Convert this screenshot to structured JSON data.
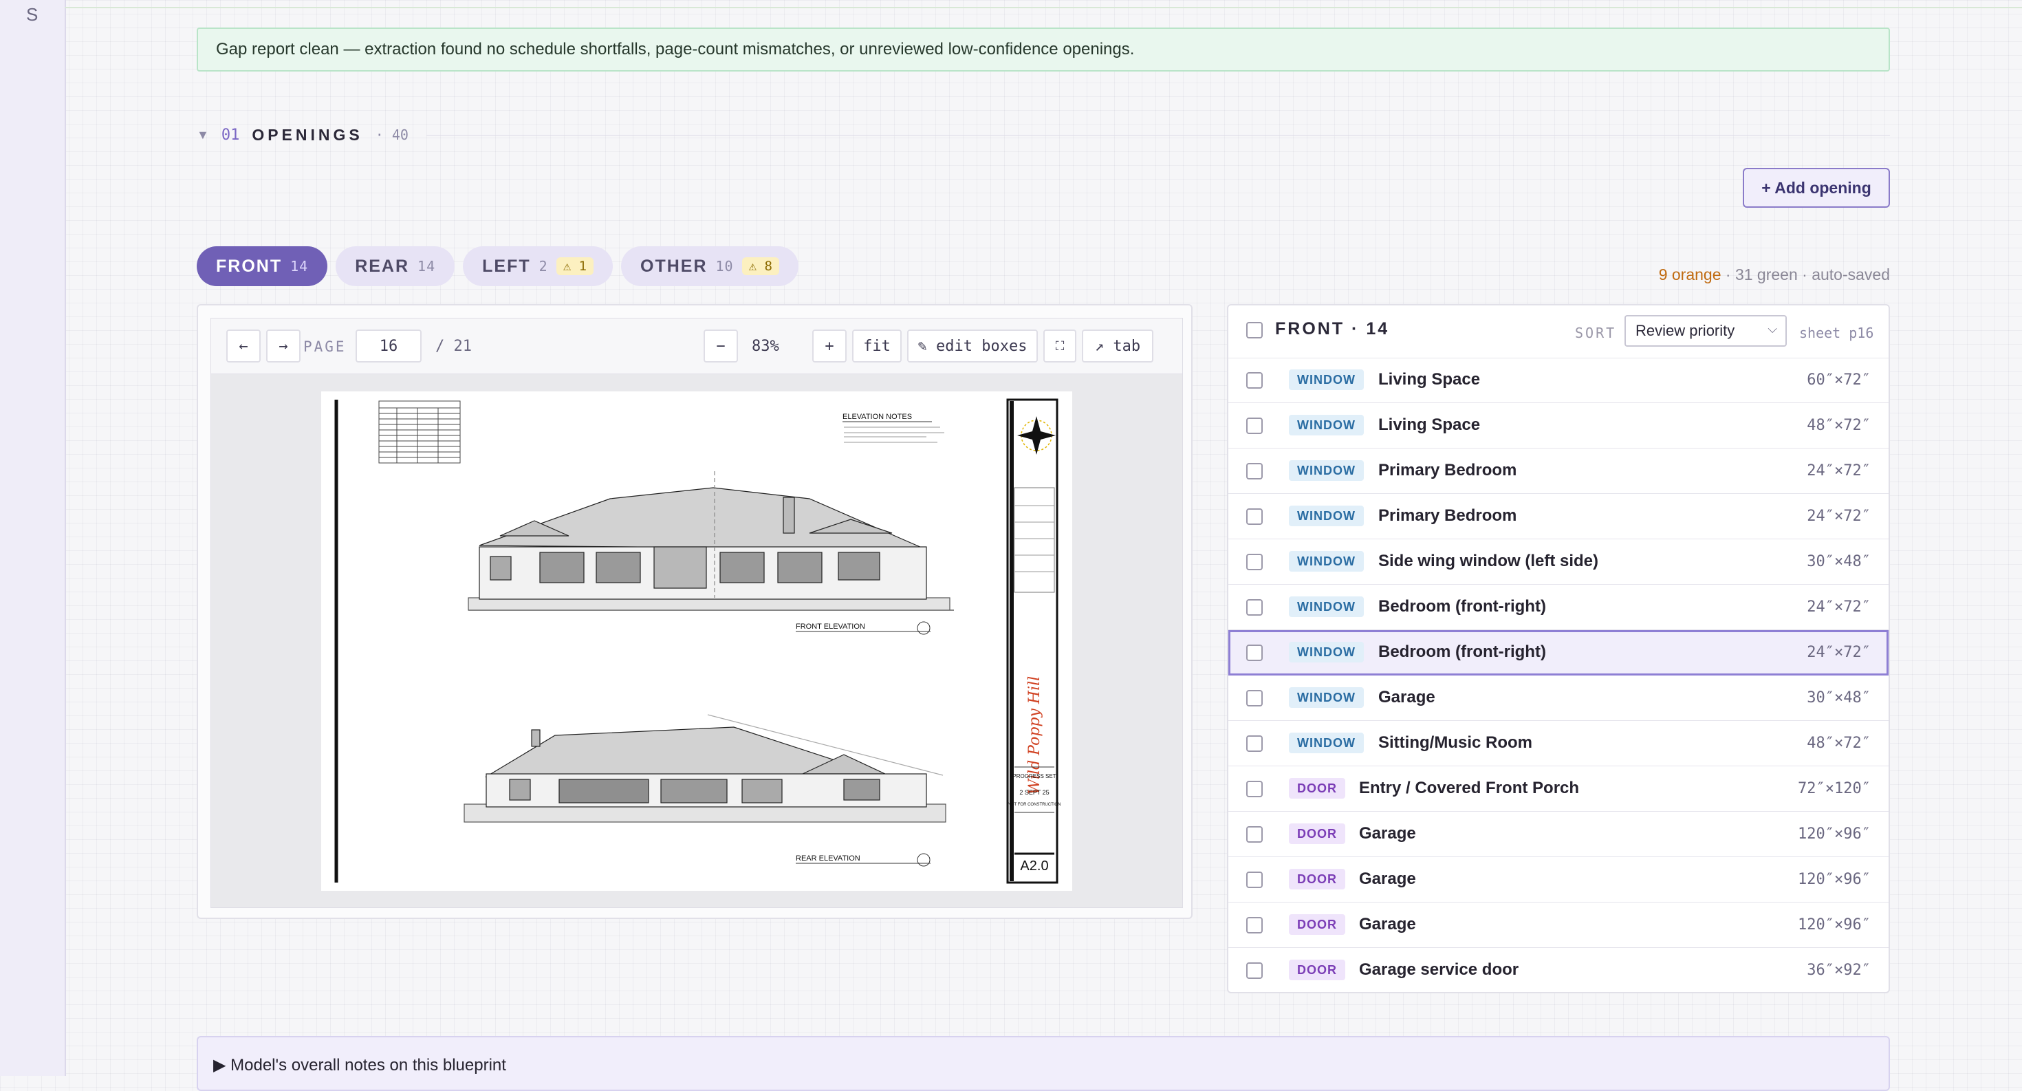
{
  "rail": {
    "letter": "S"
  },
  "gap_report": "Gap report clean — extraction found no schedule shortfalls, page-count mismatches, or unreviewed low-confidence openings.",
  "section": {
    "toggle": "▼",
    "number": "01",
    "title": "OPENINGS",
    "count": "· 40"
  },
  "add_opening_label": "+ Add opening",
  "tabs": [
    {
      "label": "FRONT",
      "count": "14",
      "warn": ""
    },
    {
      "label": "REAR",
      "count": "14",
      "warn": ""
    },
    {
      "label": "LEFT",
      "count": "2",
      "warn": "⚠ 1"
    },
    {
      "label": "OTHER",
      "count": "10",
      "warn": "⚠ 8"
    }
  ],
  "status": {
    "orange": "9 orange",
    "rest": " · 31 green · auto-saved"
  },
  "viewer": {
    "prev": "←",
    "next": "→",
    "page_label": "PAGE",
    "page": "16",
    "total": "/ 21",
    "zoom_out": "−",
    "zoom": "83%",
    "zoom_in": "+",
    "fit": "fit",
    "edit_boxes": "✎ edit boxes",
    "expand": "⛶",
    "tab": "↗ tab"
  },
  "blueprint": {
    "notes_title": "ELEVATION NOTES",
    "front_label": "FRONT ELEVATION",
    "rear_label": "REAR ELEVATION",
    "brand": "Wild Poppy Hill",
    "progress": "PROGRESS SET",
    "date": "2 SEPT 25",
    "nfc": "NOT FOR CONSTRUCTION",
    "sheet": "A2.0"
  },
  "list": {
    "title": "FRONT · 14",
    "sort_label": "SORT",
    "sort_value": "Review priority",
    "sheet": "sheet p16",
    "rows": [
      {
        "type": "WINDOW",
        "name": "Living Space",
        "dim": "60″×72″"
      },
      {
        "type": "WINDOW",
        "name": "Living Space",
        "dim": "48″×72″"
      },
      {
        "type": "WINDOW",
        "name": "Primary Bedroom",
        "dim": "24″×72″"
      },
      {
        "type": "WINDOW",
        "name": "Primary Bedroom",
        "dim": "24″×72″"
      },
      {
        "type": "WINDOW",
        "name": "Side wing window (left side)",
        "dim": "30″×48″"
      },
      {
        "type": "WINDOW",
        "name": "Bedroom (front-right)",
        "dim": "24″×72″"
      },
      {
        "type": "WINDOW",
        "name": "Bedroom (front-right)",
        "dim": "24″×72″"
      },
      {
        "type": "WINDOW",
        "name": "Garage",
        "dim": "30″×48″"
      },
      {
        "type": "WINDOW",
        "name": "Sitting/Music Room",
        "dim": "48″×72″"
      },
      {
        "type": "DOOR",
        "name": "Entry / Covered Front Porch",
        "dim": "72″×120″"
      },
      {
        "type": "DOOR",
        "name": "Garage",
        "dim": "120″×96″"
      },
      {
        "type": "DOOR",
        "name": "Garage",
        "dim": "120″×96″"
      },
      {
        "type": "DOOR",
        "name": "Garage",
        "dim": "120″×96″"
      },
      {
        "type": "DOOR",
        "name": "Garage service door",
        "dim": "36″×92″"
      }
    ]
  },
  "notes_label": "▶ Model's overall notes on this blueprint"
}
